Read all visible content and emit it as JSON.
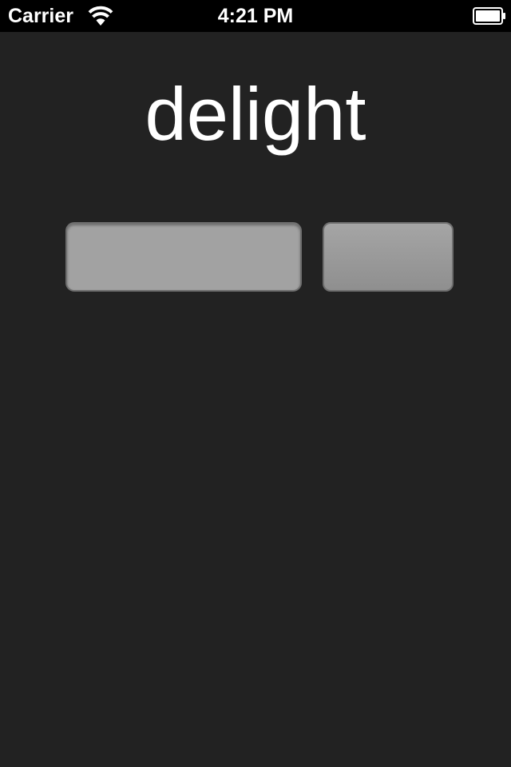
{
  "status_bar": {
    "carrier": "Carrier",
    "time": "4:21 PM",
    "wifi_icon": "wifi-icon",
    "battery_icon": "battery-icon"
  },
  "app": {
    "title": "delight"
  },
  "form": {
    "input": {
      "value": "",
      "placeholder": ""
    },
    "button_label": ""
  },
  "colors": {
    "background": "#222222",
    "status_bar": "#000000",
    "field": "#a2a2a2",
    "button": "#989898"
  }
}
